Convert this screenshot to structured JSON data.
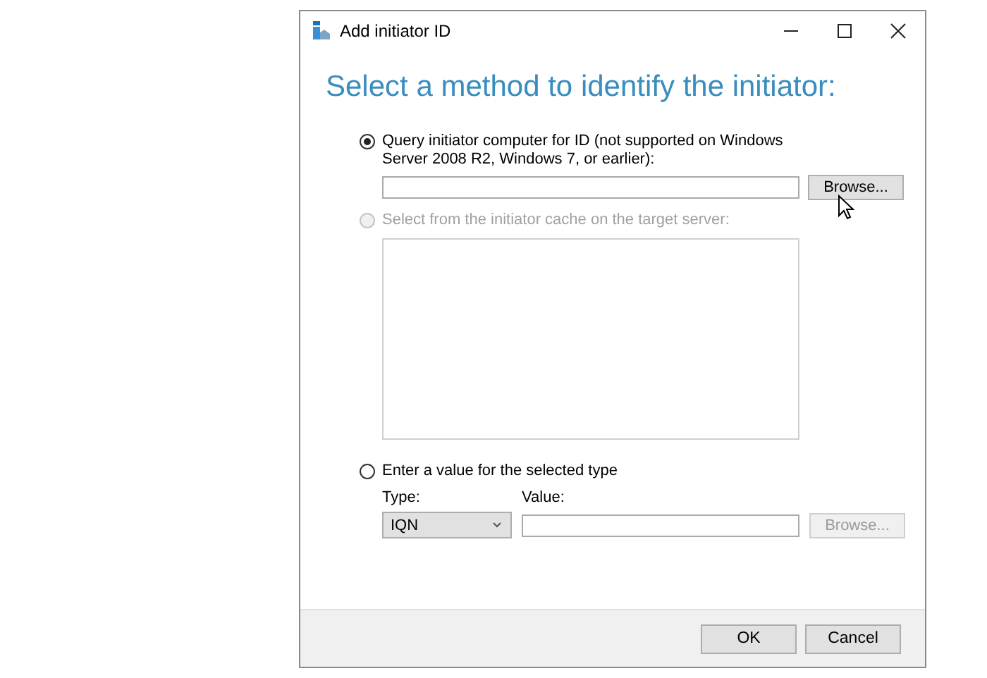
{
  "window": {
    "title": "Add initiator ID"
  },
  "heading": "Select a method to identify the initiator:",
  "options": [
    {
      "kind": "query",
      "label": "Query initiator computer for ID (not supported on Windows Server 2008 R2, Windows 7, or earlier):",
      "selected": true,
      "disabled": false,
      "browse": {
        "label": "Browse...",
        "disabled": false
      }
    },
    {
      "kind": "cache",
      "label": "Select from the initiator cache on the target server:",
      "selected": false,
      "disabled": true
    },
    {
      "kind": "manual",
      "label": "Enter a value for the selected type",
      "selected": false,
      "disabled": false,
      "type_label": "Type:",
      "type_value": "IQN",
      "value_label": "Value:",
      "browse": {
        "label": "Browse...",
        "disabled": true
      }
    }
  ],
  "buttons": [
    "OK",
    "Cancel"
  ]
}
